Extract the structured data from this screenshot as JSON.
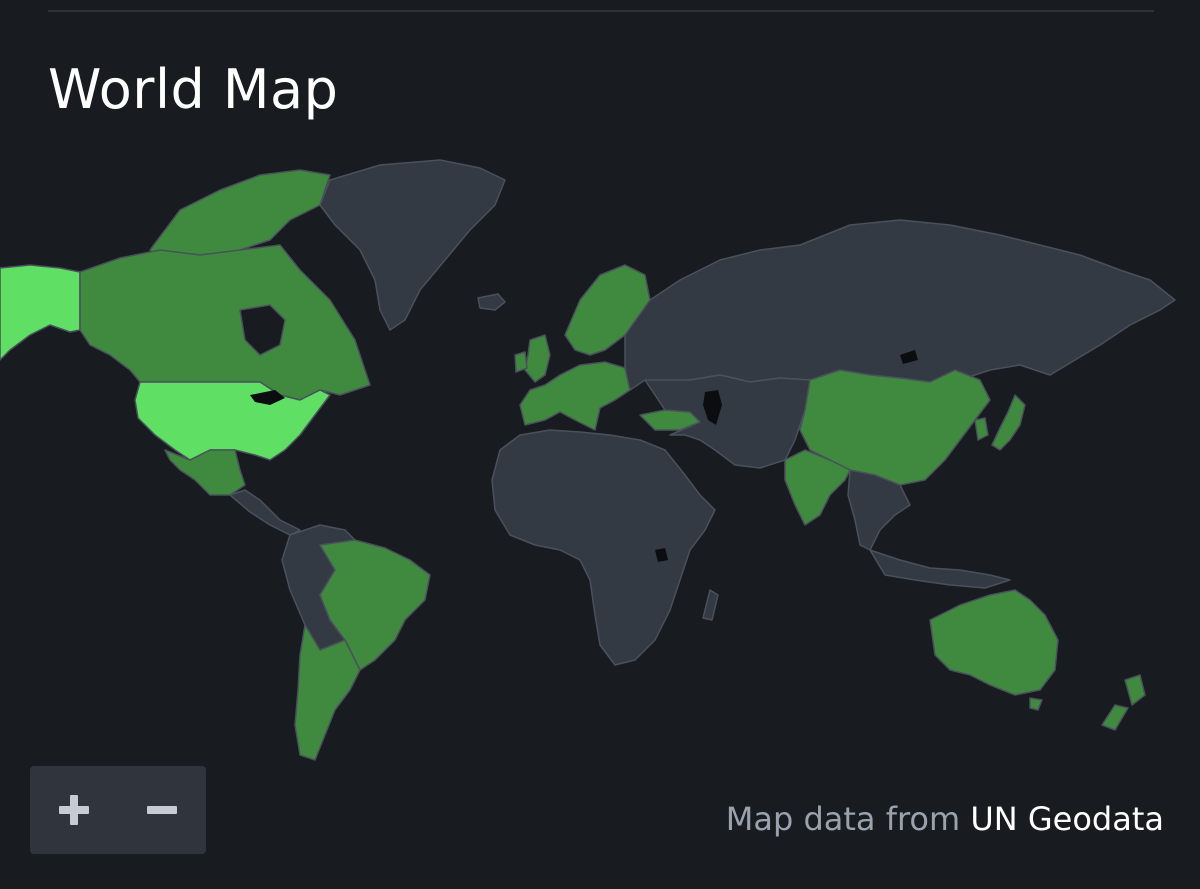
{
  "header": {
    "title": "World Map"
  },
  "map": {
    "colors": {
      "background": "#181b1f",
      "land_default": "#343a43",
      "borders": "#4a515c",
      "highlight_light": "#5fe065",
      "highlight_medium": "#3f8a3f",
      "highlight_dark": "#3a7a3c",
      "lakes": "#0b0d10"
    },
    "highlighted_light": [
      "Alaska",
      "United States"
    ],
    "highlighted_medium": [
      "Canada",
      "Mexico",
      "Brazil",
      "Argentina",
      "Chile",
      "Greenland-arctic-islands",
      "Norway",
      "Sweden",
      "Finland",
      "United Kingdom",
      "Ireland",
      "France",
      "Spain",
      "Portugal",
      "Germany",
      "Poland",
      "Italy",
      "Greece",
      "Turkey",
      "India",
      "China",
      "Japan",
      "South Korea",
      "Australia",
      "New Zealand"
    ],
    "zoom": {
      "in_icon": "plus-icon",
      "out_icon": "minus-icon"
    }
  },
  "attribution": {
    "prefix": "Map data from",
    "source": "UN Geodata"
  }
}
